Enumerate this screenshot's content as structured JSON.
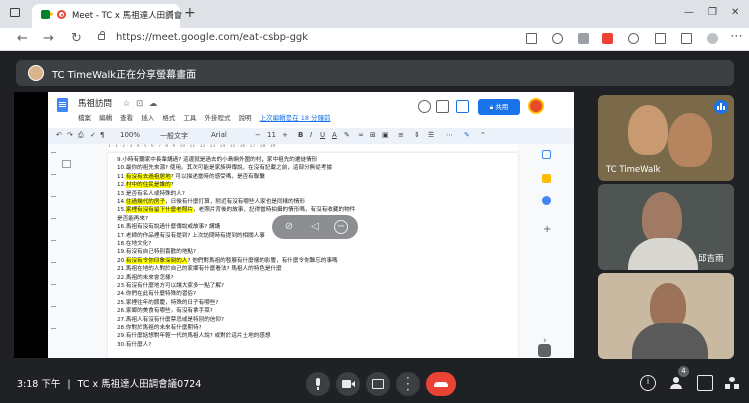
{
  "browser": {
    "tab_title": "Meet - TC x 馬祖達人田調會",
    "tab_close": "×",
    "new_tab": "+",
    "url": "https://meet.google.com/eat-csbp-ggk",
    "window_controls": [
      "—",
      "❐",
      "✕"
    ]
  },
  "meet": {
    "presenter_text": "TC TimeWalk正在分享螢幕畫面",
    "time": "3:18 下午",
    "separator": "|",
    "meeting_title": "TC x 馬祖達人田調會議0724",
    "participant_count": "4",
    "participants": [
      {
        "name": "TC TimeWalk",
        "speaking": true
      },
      {
        "name": "邱吉雨",
        "speaking": false
      },
      {
        "name": "",
        "speaking": false
      }
    ],
    "colors": {
      "accent": "#1a73e8",
      "hangup": "#ea4335",
      "bg": "#202124",
      "highlight": "#ffff00"
    }
  },
  "docs": {
    "title": "馬祖訪問",
    "menu": [
      "檔案",
      "編輯",
      "查看",
      "插入",
      "格式",
      "工具",
      "外掛程式",
      "說明"
    ],
    "last_edit": "上次編輯是在 18 分鐘前",
    "share_label": "共用",
    "toolbar": {
      "zoom": "100%",
      "style": "一般文字",
      "font": "Arial",
      "font_size": "11"
    },
    "ruler": "1 · 1 · 2 · 3 · 4 · 5 · 6 · 7 · 8 · 9 · 10 · 11 · 12 · 13 · 14 · 15 · 16 · 17 · 18 · 19",
    "lines": [
      {
        "pre": "9.小時有聽家中長輩講過? 這邊就是過去的小島嶼外圍的村，家中祖先的遷徙情形",
        "hl": "",
        "post": ""
      },
      {
        "pre": "10.最你的祖先來源? 使用",
        "hl": "",
        "post": "。其次可能是家族與傳說，在沒有記載之前，這部分無從考據"
      },
      {
        "pre": "11.",
        "hl": "有沒有去過祖居地",
        "post": "? 可以描述當時的感受嗎，是否有聯繫"
      },
      {
        "pre": "12.",
        "hl": "村中的住民是誰的",
        "post": "?"
      },
      {
        "pre": "13.是否有名人或特殊的人?",
        "hl": "",
        "post": ""
      },
      {
        "pre": "14.",
        "hl": "住過幾代的房子",
        "post": "，日後有什麼打算，附近有沒有哪些人家也是同樣的情形"
      },
      {
        "pre": "15.",
        "hl": "家裡有沒有留下什麼老照片",
        "post": "，老照片背後的故事，記得當時拍攝的情形嗎，有沒有收藏的物件"
      },
      {
        "pre": "是否能再來?",
        "hl": "",
        "post": ""
      },
      {
        "pre": "16.馬祖有沒有說過什麼傳說或故事? 講講",
        "hl": "",
        "post": ""
      },
      {
        "pre": "17.老師的作品裡有沒有提到? 上次訪問時有提到的相關人事",
        "hl": "",
        "post": ""
      },
      {
        "pre": "18.在地文化?",
        "hl": "",
        "post": ""
      },
      {
        "pre": "19.有沒有自己特別喜歡的地點?",
        "hl": "",
        "post": ""
      },
      {
        "pre": "20.",
        "hl": "有沒有令你印象深刻的人",
        "post": "? 他們對馬祖的發展有什麼樣的影響，有什麼令你難忘的事嗎"
      },
      {
        "pre": "21.馬祖在地的人對於自己的家鄉有什麼看法? 馬祖人的特色是什麼",
        "hl": "",
        "post": ""
      },
      {
        "pre": "22.馬祖的未來會怎樣?",
        "hl": "",
        "post": ""
      },
      {
        "pre": "23.有沒有什麼地方可以讓大家多一點了解?",
        "hl": "",
        "post": ""
      },
      {
        "pre": "24.你們在此有什麼特殊的習俗?",
        "hl": "",
        "post": ""
      },
      {
        "pre": "25.家裡往年的節慶，特殊的日子有哪些?",
        "hl": "",
        "post": ""
      },
      {
        "pre": "26.家鄉的美食有哪些，有沒有拿手菜?",
        "hl": "",
        "post": ""
      },
      {
        "pre": "27.馬祖人有沒有什麼禁忌或是特別的信仰?",
        "hl": "",
        "post": ""
      },
      {
        "pre": "28.你對於馬祖的未來有什麼期待?",
        "hl": "",
        "post": ""
      },
      {
        "pre": "29.有什麼話想對年輕一代的馬祖人說? 或對於這片土地的感想",
        "hl": "",
        "post": ""
      },
      {
        "pre": "30.有什麼人?",
        "hl": "",
        "post": ""
      }
    ]
  }
}
